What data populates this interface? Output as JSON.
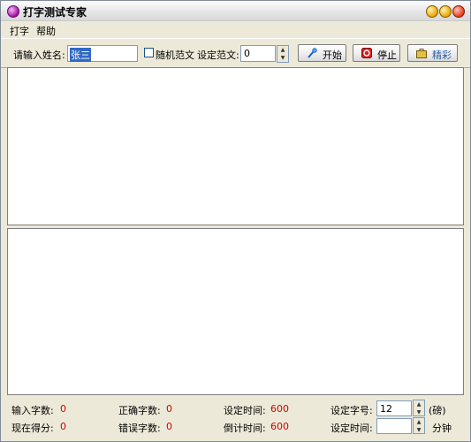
{
  "window": {
    "title": "打字测试专家"
  },
  "menu": {
    "items": [
      "打字",
      "帮助"
    ]
  },
  "toolbar": {
    "name_label": "请输入姓名:",
    "name_value": "张三",
    "random_label": "随机范文",
    "set_text_label": "设定范文:",
    "set_text_value": "0",
    "start_label": "开始",
    "stop_label": "停止",
    "highlight_label": "精彩"
  },
  "status": {
    "typed_label": "输入字数:",
    "typed_value": "0",
    "correct_label": "正确字数:",
    "correct_value": "0",
    "set_time_label": "设定时间:",
    "set_time_value": "600",
    "font_size_label": "设定字号:",
    "font_size_value": "12",
    "font_unit": "(磅)",
    "score_label": "现在得分:",
    "score_value": "0",
    "error_label": "错误字数:",
    "error_value": "0",
    "countdown_label": "倒计时间:",
    "countdown_value": "600",
    "set_time2_label": "设定时间:",
    "minute_unit": "分钟"
  },
  "colors": {
    "value_red": "#d40000",
    "accent_blue": "#2b5ea8"
  }
}
